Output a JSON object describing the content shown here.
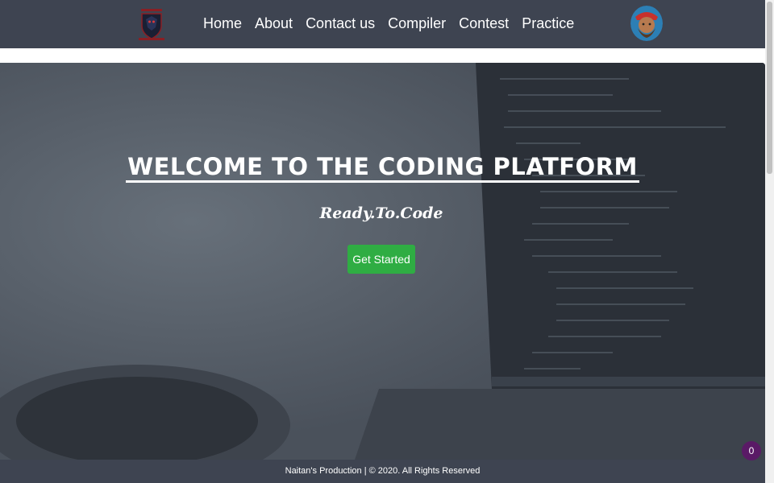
{
  "navbar": {
    "links": [
      "Home",
      "About",
      "Contact us",
      "Compiler",
      "Contest",
      "Practice"
    ]
  },
  "hero": {
    "title": "WELCOME TO THE CODING PLATFORM",
    "subtitle": "Ready.To.Code",
    "cta_label": "Get Started"
  },
  "footer": {
    "text": "Naitan's Production | © 2020. All Rights Reserved"
  },
  "badge": {
    "count": "0"
  },
  "colors": {
    "navbar_bg": "#3e4451",
    "cta_bg": "#2fad43",
    "badge_bg": "#5a1a66"
  },
  "icons": {
    "logo": "shield-logo-icon",
    "avatar": "user-avatar"
  }
}
